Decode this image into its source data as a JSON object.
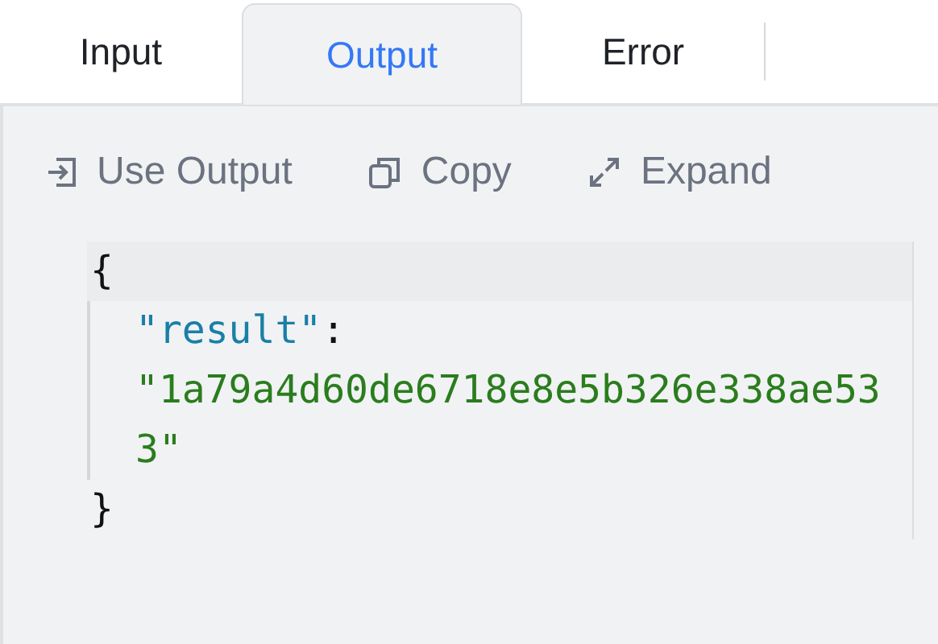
{
  "tabs": [
    {
      "label": "Input",
      "selected": false
    },
    {
      "label": "Output",
      "selected": true
    },
    {
      "label": "Error",
      "selected": false
    }
  ],
  "toolbar": [
    {
      "kind": "use",
      "label": "Use Output"
    },
    {
      "kind": "copy",
      "label": "Copy"
    },
    {
      "kind": "expand",
      "label": "Expand"
    }
  ],
  "code": {
    "open": "{",
    "key": "\"result\"",
    "colon": ":",
    "value": "\"1a79a4d60de6718e8e5b326e338ae533\"",
    "close": "}"
  }
}
